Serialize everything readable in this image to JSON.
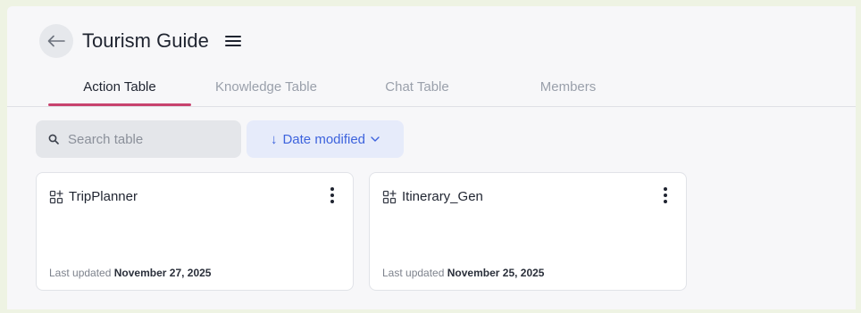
{
  "header": {
    "title": "Tourism Guide",
    "back_icon": "arrow-left-icon",
    "menu_icon": "hamburger-menu-icon"
  },
  "tabs": [
    {
      "label": "Action Table",
      "active": true
    },
    {
      "label": "Knowledge Table",
      "active": false
    },
    {
      "label": "Chat Table",
      "active": false
    },
    {
      "label": "Members",
      "active": false
    }
  ],
  "search": {
    "placeholder": "Search table",
    "value": "",
    "icon": "search-icon"
  },
  "sort": {
    "label": "Date modified",
    "icon": "arrow-down-icon",
    "dropdown_icon": "chevron-down-icon"
  },
  "cards": [
    {
      "name": "TripPlanner",
      "icon": "table-grid-icon",
      "updated_prefix": "Last updated",
      "updated_date": "November 27, 2025"
    },
    {
      "name": "Itinerary_Gen",
      "icon": "table-grid-icon",
      "updated_prefix": "Last updated",
      "updated_date": "November 25, 2025"
    }
  ],
  "colors": {
    "accent_tab": "#c8426e",
    "sort_text": "#3d63dd",
    "sort_bg": "#e6ebfa",
    "page_bg": "#f7f7f9",
    "outer_bg": "#eef3e3"
  }
}
